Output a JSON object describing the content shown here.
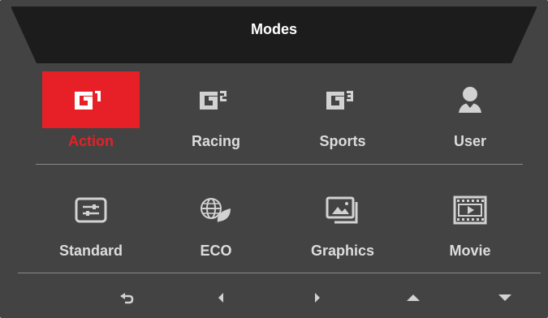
{
  "menu": {
    "title": "Modes",
    "selected_index": 0,
    "modes_row1": [
      {
        "label": "Action",
        "icon": "g1-icon",
        "glyph": "G",
        "sup": "1"
      },
      {
        "label": "Racing",
        "icon": "g2-icon",
        "glyph": "G",
        "sup": "2"
      },
      {
        "label": "Sports",
        "icon": "g3-icon",
        "glyph": "G",
        "sup": "3"
      },
      {
        "label": "User",
        "icon": "user-icon"
      }
    ],
    "modes_row2": [
      {
        "label": "Standard",
        "icon": "sliders-icon"
      },
      {
        "label": "ECO",
        "icon": "eco-globe-leaf-icon"
      },
      {
        "label": "Graphics",
        "icon": "graphics-picture-icon"
      },
      {
        "label": "Movie",
        "icon": "film-icon"
      }
    ],
    "nav": [
      {
        "icon": "back-icon"
      },
      {
        "icon": "left-arrow-icon"
      },
      {
        "icon": "right-arrow-icon"
      },
      {
        "icon": "up-arrow-icon"
      },
      {
        "icon": "down-arrow-icon"
      }
    ]
  },
  "colors": {
    "panel": "#434343",
    "titlebar": "#1c1c1c",
    "accent": "#e62026",
    "text": "#dcdcdc"
  }
}
